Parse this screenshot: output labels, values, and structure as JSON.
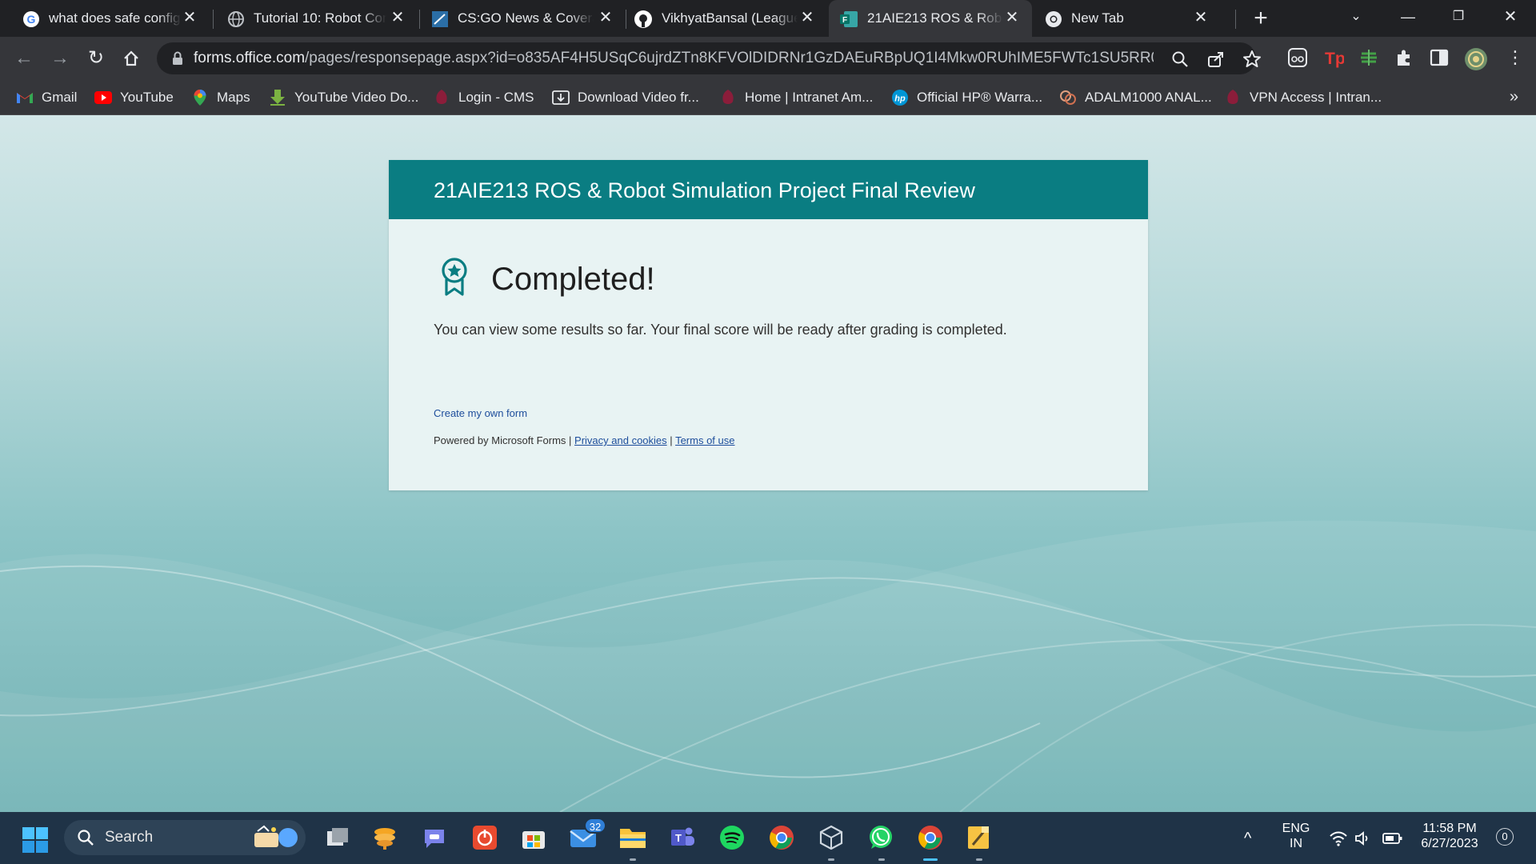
{
  "tabs": [
    {
      "title": "what does safe configu",
      "icon": "google-icon"
    },
    {
      "title": "Tutorial 10: Robot Con",
      "icon": "globe-icon"
    },
    {
      "title": "CS:GO News & Covera",
      "icon": "hltv-icon"
    },
    {
      "title": "VikhyatBansal (League",
      "icon": "github-icon"
    },
    {
      "title": "21AIE213 ROS & Robo",
      "icon": "forms-icon",
      "active": true
    },
    {
      "title": "New Tab",
      "icon": "chrome-icon"
    }
  ],
  "address_bar": {
    "host": "forms.office.com",
    "path": "/pages/responsepage.aspx?id=o835AF4H5USqC6ujrdZTn8KFVOlDIDRNr1GzDAEuRBpUQ1I4Mkw0RUhIME5FWTc1SU5RR0..."
  },
  "bookmarks": [
    {
      "label": "Gmail",
      "icon": "gmail-icon"
    },
    {
      "label": "YouTube",
      "icon": "youtube-icon"
    },
    {
      "label": "Maps",
      "icon": "maps-icon"
    },
    {
      "label": "YouTube Video Do...",
      "icon": "download-arrow-icon"
    },
    {
      "label": "Login - CMS",
      "icon": "university-logo-icon"
    },
    {
      "label": "Download Video fr...",
      "icon": "video-download-icon"
    },
    {
      "label": "Home | Intranet Am...",
      "icon": "university-logo-icon"
    },
    {
      "label": "Official HP® Warra...",
      "icon": "hp-icon"
    },
    {
      "label": "ADALM1000 ANAL...",
      "icon": "adalm-icon"
    },
    {
      "label": "VPN Access | Intran...",
      "icon": "university-logo-icon"
    }
  ],
  "form": {
    "title": "21AIE213 ROS & Robot Simulation Project Final Review",
    "status_heading": "Completed!",
    "message": "You can view some results so far. Your final score will be ready after grading is completed.",
    "create_link": "Create my own form",
    "powered_by": "Powered by Microsoft Forms |",
    "privacy_link": "Privacy and cookies",
    "separator": "|",
    "terms_link": "Terms of use",
    "accent_color": "#0a7d82"
  },
  "taskbar": {
    "search_label": "Search",
    "mail_badge": "32",
    "language_line1": "ENG",
    "language_line2": "IN",
    "time": "11:58 PM",
    "date": "6/27/2023",
    "notification_count": "0"
  }
}
